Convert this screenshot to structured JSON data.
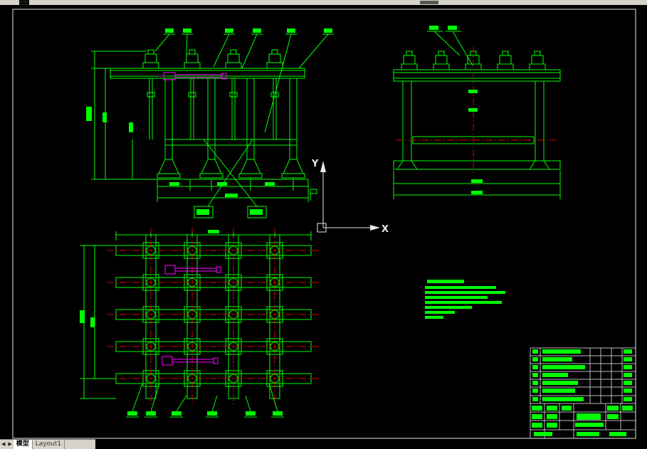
{
  "tabs": {
    "nav_prev_icon": "◀",
    "nav_next_icon": "▶",
    "model_label": "模型",
    "layout_label": "Layout1"
  },
  "ucs": {
    "x_label": "X",
    "y_label": "Y"
  },
  "colors": {
    "green": "#00ff00",
    "red": "#d40000",
    "magenta": "#ff00ff",
    "white": "#e8e8e8",
    "table": "#b8b8b8",
    "chrome": "#d6d2c8",
    "bg": "#000000"
  }
}
